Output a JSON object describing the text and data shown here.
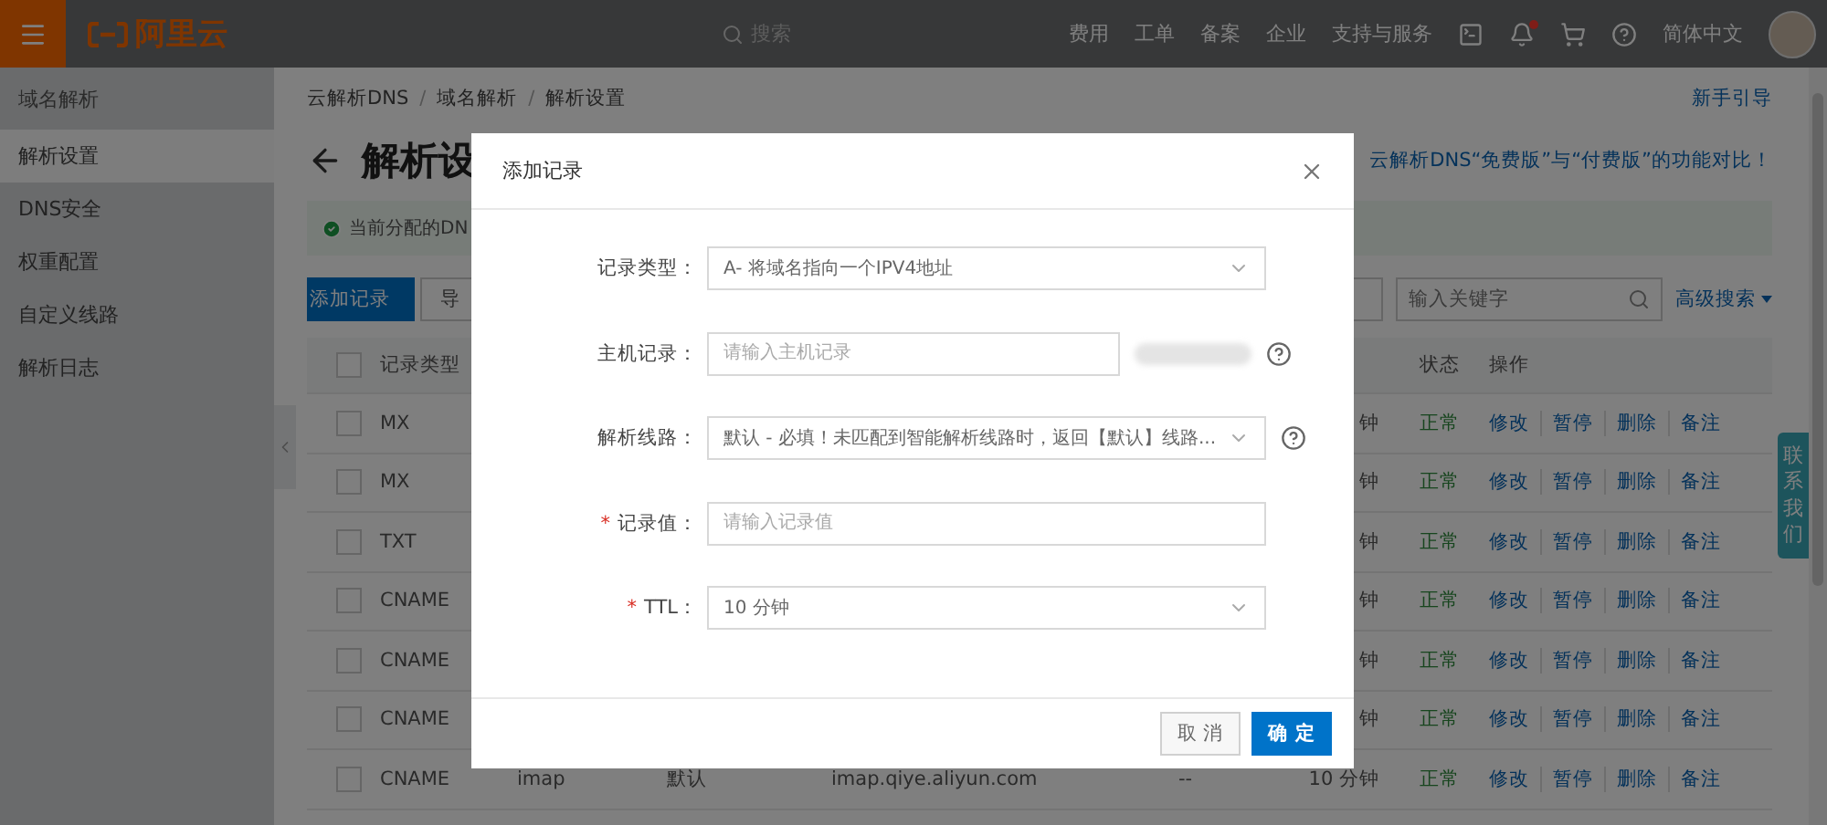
{
  "header": {
    "logo_text": "阿里云",
    "search_placeholder": "搜索",
    "nav": [
      "费用",
      "工单",
      "备案",
      "企业",
      "支持与服务"
    ],
    "notifications_unread": true,
    "language": "简体中文"
  },
  "sidebar": {
    "title": "域名解析",
    "items": [
      {
        "label": "解析设置",
        "selected": true
      },
      {
        "label": "DNS安全",
        "selected": false
      },
      {
        "label": "权重配置",
        "selected": false
      },
      {
        "label": "自定义线路",
        "selected": false
      },
      {
        "label": "解析日志",
        "selected": false
      }
    ]
  },
  "breadcrumb": {
    "separator": "/",
    "items": [
      "云解析DNS",
      "域名解析",
      "解析设置"
    ]
  },
  "guide_link": "新手引导",
  "page_title": "解析设",
  "compare_link": "云解析DNS“免费版”与“付费版”的功能对比！",
  "alert": {
    "text": "当前分配的DN"
  },
  "toolbar": {
    "buttons": [
      {
        "label": "添加记录",
        "primary": true
      },
      {
        "label": "导",
        "primary": false
      }
    ],
    "search_placeholder": "输入关键字",
    "advanced_search": "高级搜索"
  },
  "table": {
    "select_all_checked": false,
    "columns": [
      "记录类型",
      "状态",
      "操作"
    ],
    "rows": [
      {
        "checked": false,
        "type": "MX",
        "ttl": "钟",
        "status": "正常",
        "actions": [
          "修改",
          "暂停",
          "删除",
          "备注"
        ]
      },
      {
        "checked": false,
        "type": "MX",
        "ttl": "钟",
        "status": "正常",
        "actions": [
          "修改",
          "暂停",
          "删除",
          "备注"
        ]
      },
      {
        "checked": false,
        "type": "TXT",
        "ttl": "钟",
        "status": "正常",
        "actions": [
          "修改",
          "暂停",
          "删除",
          "备注"
        ]
      },
      {
        "checked": false,
        "type": "CNAME",
        "ttl": "钟",
        "status": "正常",
        "actions": [
          "修改",
          "暂停",
          "删除",
          "备注"
        ]
      },
      {
        "checked": false,
        "type": "CNAME",
        "ttl": "钟",
        "status": "正常",
        "actions": [
          "修改",
          "暂停",
          "删除",
          "备注"
        ]
      },
      {
        "checked": false,
        "type": "CNAME",
        "ttl": "钟",
        "status": "正常",
        "actions": [
          "修改",
          "暂停",
          "删除",
          "备注"
        ]
      },
      {
        "checked": false,
        "type": "CNAME",
        "host": "imap",
        "line": "默认",
        "value": "imap.qiye.aliyun.com",
        "priority": "--",
        "ttl": "10 分钟",
        "status": "正常",
        "actions": [
          "修改",
          "暂停",
          "删除",
          "备注"
        ]
      }
    ]
  },
  "contact_tab": "联系我们",
  "dialog": {
    "title": "添加记录",
    "fields": [
      {
        "kind": "select",
        "label": "记录类型：",
        "value": "A- 将域名指向一个IPV4地址",
        "help": false
      },
      {
        "kind": "input",
        "label": "主机记录：",
        "placeholder": "请输入主机记录",
        "suffix_redacted": true,
        "help": true
      },
      {
        "kind": "select",
        "label": "解析线路：",
        "value": "默认 - 必填！未匹配到智能解析线路时，返回【默认】线路...",
        "help": true
      },
      {
        "kind": "input",
        "required_mark": "*",
        "label": "记录值：",
        "placeholder": "请输入记录值",
        "help": false
      },
      {
        "kind": "select",
        "required_mark": "*",
        "label": "TTL：",
        "value": "10 分钟",
        "help": false
      }
    ],
    "buttons": [
      {
        "label": "取 消",
        "primary": false
      },
      {
        "label": "确 定",
        "primary": true
      }
    ]
  }
}
